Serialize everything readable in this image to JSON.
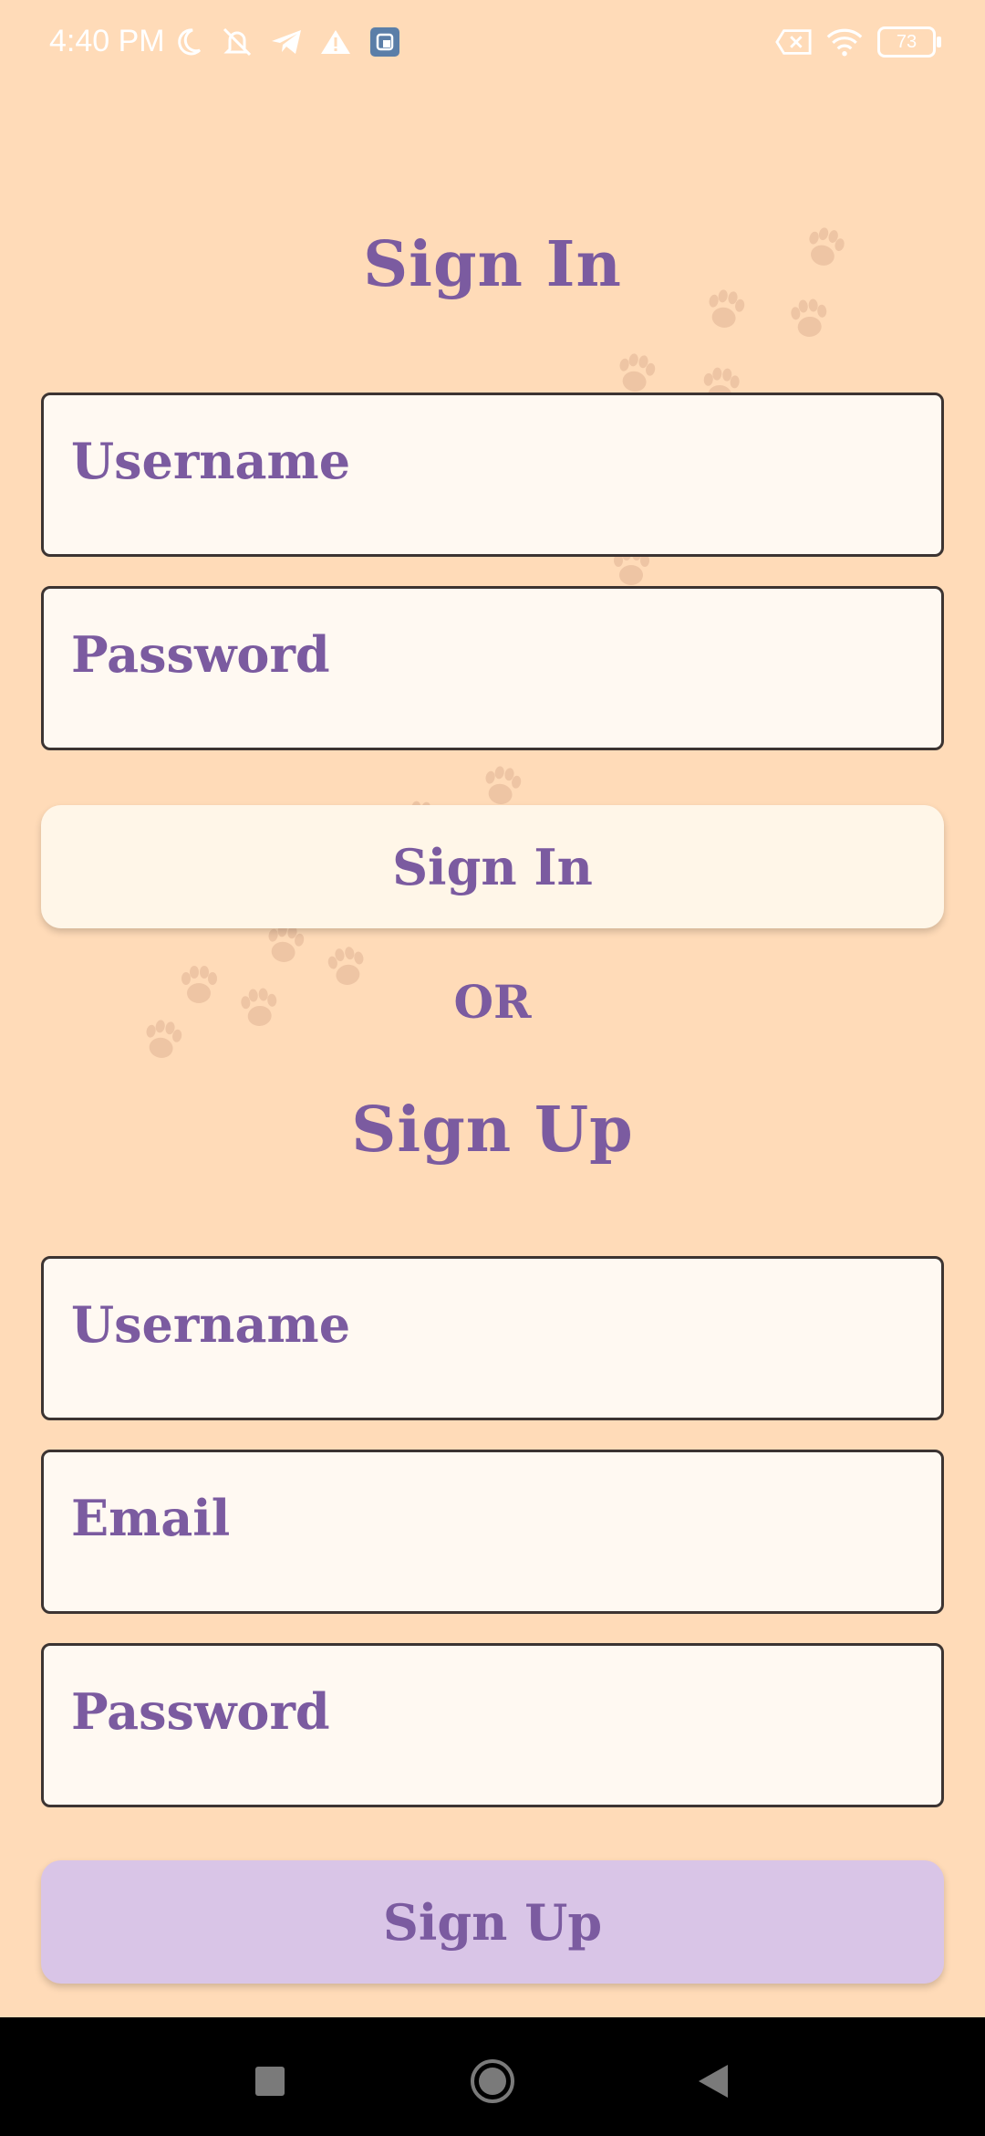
{
  "status_bar": {
    "time": "4:40 PM",
    "battery": "73",
    "icons_left": [
      "moon-icon",
      "bell-off-icon",
      "telegram-icon",
      "warning-icon",
      "app-notification-icon"
    ],
    "icons_right": [
      "sim-x-icon",
      "wifi-icon",
      "battery-icon"
    ]
  },
  "sign_in": {
    "title": "Sign In",
    "username_placeholder": "Username",
    "password_placeholder": "Password",
    "button_label": "Sign In"
  },
  "divider_label": "OR",
  "sign_up": {
    "title": "Sign Up",
    "username_placeholder": "Username",
    "email_placeholder": "Email",
    "password_placeholder": "Password",
    "button_label": "Sign Up"
  },
  "nav_bar": {
    "buttons": [
      "recents-icon",
      "home-icon",
      "back-icon"
    ]
  },
  "colors": {
    "background": "#FFDBB8",
    "accent": "#7B5BA0",
    "field_bg": "#FFF9F2",
    "signin_button": "#FFF6E8",
    "signup_button": "#D9C5E7"
  }
}
